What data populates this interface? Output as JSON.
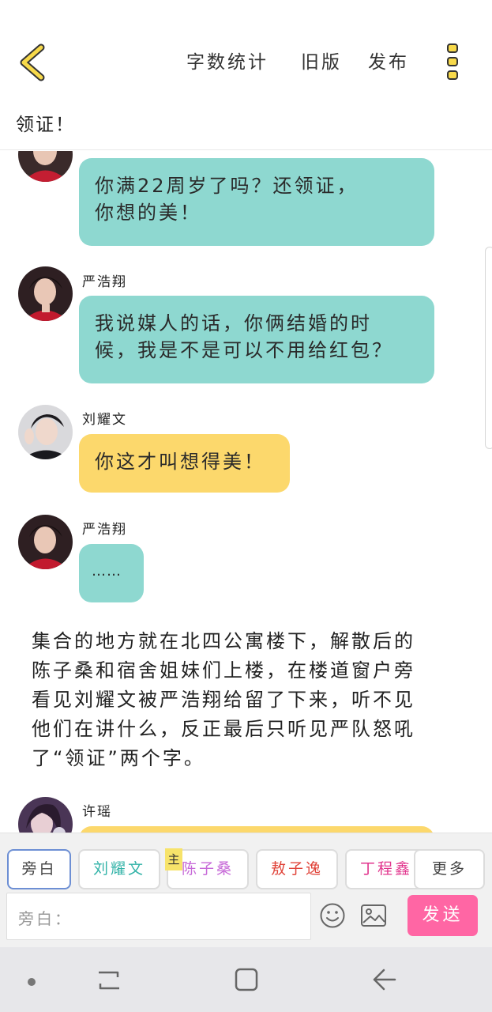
{
  "header": {
    "word_count_label": "字数统计",
    "old_version_label": "旧版",
    "publish_label": "发布",
    "chapter_title": "领证！"
  },
  "messages": [
    {
      "speaker": "",
      "text_lines": [
        "你满22周岁了吗？还领证，",
        "你想的美！"
      ],
      "color": "#8ed8d0"
    },
    {
      "speaker": "严浩翔",
      "text_lines": [
        "我说媒人的话，你俩结婚的时",
        "候，我是不是可以不用给红包？"
      ],
      "color": "#8ed8d0"
    },
    {
      "speaker": "刘耀文",
      "text_lines": [
        "你这才叫想得美！"
      ],
      "color": "#fcd86c"
    },
    {
      "speaker": "严浩翔",
      "text_lines": [
        "……"
      ],
      "color": "#8ed8d0"
    },
    {
      "speaker": "许瑶",
      "text_lines": [
        ""
      ],
      "color": "#fcd86c"
    }
  ],
  "narration_lines": [
    "集合的地方就在北四公寓楼下，解散后的",
    "陈子桑和宿舍姐妹们上楼，在楼道窗户旁",
    "看见刘耀文被严浩翔给留了下来，听不见",
    "他们在讲什么，反正最后只听见严队怒吼",
    "了“领证”两个字。"
  ],
  "composer": {
    "roles": [
      {
        "label": "旁白",
        "color": "#444444"
      },
      {
        "label": "刘耀文",
        "color": "#33b3a8"
      },
      {
        "label": "陈子桑",
        "color": "#c76ad8"
      },
      {
        "label": "敖子逸",
        "color": "#e0443a"
      },
      {
        "label": "丁程鑫",
        "color": "#e2368e"
      }
    ],
    "main_tag": "主",
    "more_label": "更多",
    "input_label": "旁白：",
    "send_label": "发送"
  },
  "colors": {
    "accent_yellow": "#f7d94a",
    "teal_bubble": "#8ed8d0",
    "yellow_bubble": "#fcd86c",
    "send_pink": "#ff66a4"
  }
}
